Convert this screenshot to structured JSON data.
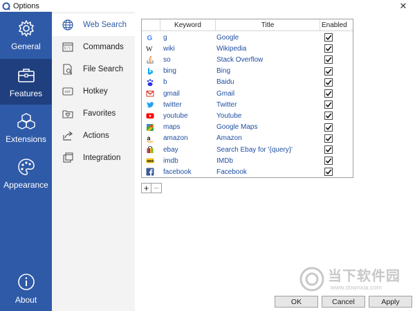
{
  "window": {
    "title": "Options"
  },
  "leftnav": {
    "items": [
      {
        "label": "General",
        "icon": "gear-icon"
      },
      {
        "label": "Features",
        "icon": "briefcase-icon",
        "active": true
      },
      {
        "label": "Extensions",
        "icon": "cubes-icon"
      },
      {
        "label": "Appearance",
        "icon": "palette-icon"
      },
      {
        "label": "About",
        "icon": "info-icon"
      }
    ]
  },
  "subnav": {
    "items": [
      {
        "label": "Web Search",
        "icon": "globe-icon",
        "active": true
      },
      {
        "label": "Commands",
        "icon": "terminal-icon"
      },
      {
        "label": "File Search",
        "icon": "file-search-icon"
      },
      {
        "label": "Hotkey",
        "icon": "keyboard-icon"
      },
      {
        "label": "Favorites",
        "icon": "heart-folder-icon"
      },
      {
        "label": "Actions",
        "icon": "share-arrow-icon"
      },
      {
        "label": "Integration",
        "icon": "windows-icon"
      }
    ]
  },
  "table": {
    "headers": {
      "keyword": "Keyword",
      "title": "Title",
      "enabled": "Enabled"
    },
    "rows": [
      {
        "keyword": "g",
        "title": "Google",
        "enabled": true,
        "icon": "google-icon"
      },
      {
        "keyword": "wiki",
        "title": "Wikipedia",
        "enabled": true,
        "icon": "wikipedia-icon"
      },
      {
        "keyword": "so",
        "title": "Stack Overflow",
        "enabled": true,
        "icon": "stackoverflow-icon"
      },
      {
        "keyword": "bing",
        "title": "Bing",
        "enabled": true,
        "icon": "bing-icon"
      },
      {
        "keyword": "b",
        "title": "Baidu",
        "enabled": true,
        "icon": "baidu-icon"
      },
      {
        "keyword": "gmail",
        "title": "Gmail",
        "enabled": true,
        "icon": "gmail-icon"
      },
      {
        "keyword": "twitter",
        "title": "Twitter",
        "enabled": true,
        "icon": "twitter-icon"
      },
      {
        "keyword": "youtube",
        "title": "Youtube",
        "enabled": true,
        "icon": "youtube-icon"
      },
      {
        "keyword": "maps",
        "title": "Google Maps",
        "enabled": true,
        "icon": "google-maps-icon"
      },
      {
        "keyword": "amazon",
        "title": "Amazon",
        "enabled": true,
        "icon": "amazon-icon"
      },
      {
        "keyword": "ebay",
        "title": "Search Ebay for '{query}'",
        "enabled": true,
        "icon": "ebay-icon"
      },
      {
        "keyword": "imdb",
        "title": "IMDb",
        "enabled": true,
        "icon": "imdb-icon"
      },
      {
        "keyword": "facebook",
        "title": "Facebook",
        "enabled": true,
        "icon": "facebook-icon"
      }
    ]
  },
  "controls": {
    "add_label": "+",
    "remove_label": "−"
  },
  "buttons": {
    "ok": "OK",
    "cancel": "Cancel",
    "apply": "Apply"
  },
  "watermark": {
    "text": "当下软件园",
    "url": "www.downxia.com"
  },
  "colors": {
    "nav_bg": "#2f5aa8",
    "nav_active": "#1f3f7f",
    "link": "#1f4ea1"
  }
}
